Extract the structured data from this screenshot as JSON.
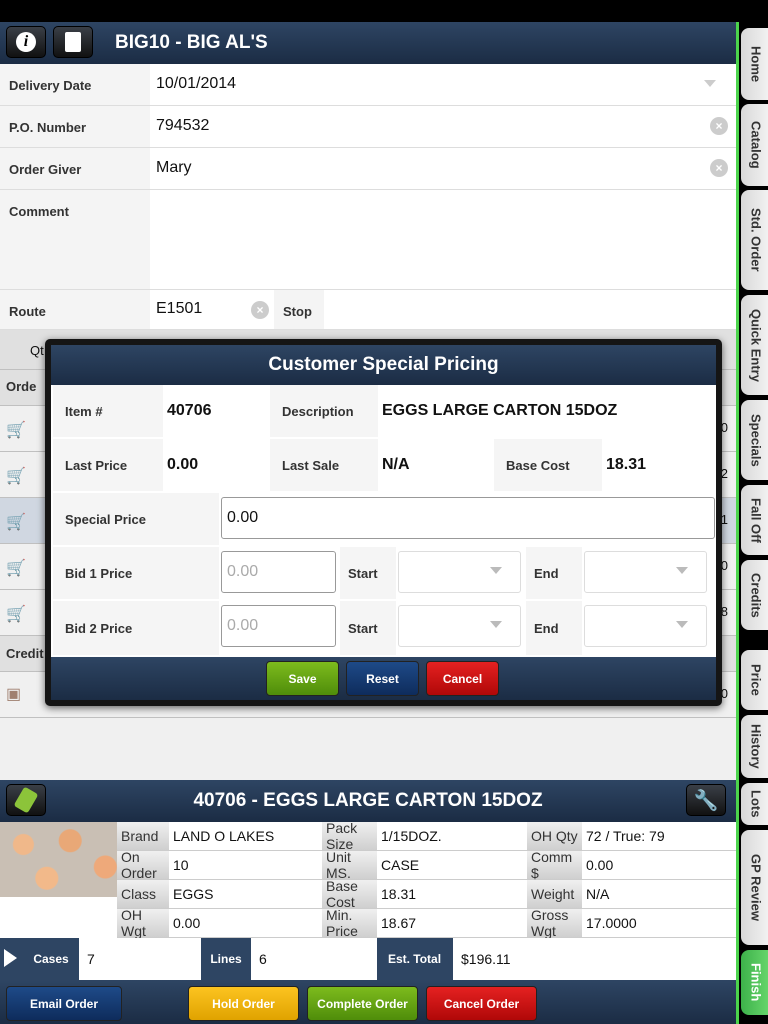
{
  "header": {
    "title": "BIG10 - BIG AL'S",
    "info_icon": "info-icon",
    "calculator_icon": "calculator-icon"
  },
  "form": {
    "delivery_date": {
      "label": "Delivery Date",
      "value": "10/01/2014"
    },
    "po_number": {
      "label": "P.O. Number",
      "value": "794532"
    },
    "order_giver": {
      "label": "Order Giver",
      "value": "Mary"
    },
    "comment": {
      "label": "Comment",
      "value": ""
    },
    "route": {
      "label": "Route",
      "value": "E1501"
    },
    "stop": {
      "label": "Stop",
      "value": ""
    }
  },
  "background_table": {
    "qty_header": "Qt",
    "ordered_section": "Orde",
    "credit_section": "Credit",
    "row_tails": [
      "0",
      "2",
      "1",
      "0",
      "8"
    ],
    "credit_tail": "0"
  },
  "sidebar": {
    "tabs": [
      "Home",
      "Catalog",
      "Std. Order",
      "Quick Entry",
      "Specials",
      "Fall Off",
      "Credits",
      "Price",
      "History",
      "Lots",
      "GP Review",
      "Finish"
    ]
  },
  "dialog": {
    "title": "Customer Special Pricing",
    "item_label": "Item #",
    "item_value": "40706",
    "description_label": "Description",
    "description_value": "EGGS LARGE CARTON 15DOZ",
    "last_price_label": "Last Price",
    "last_price_value": "0.00",
    "last_sale_label": "Last Sale",
    "last_sale_value": "N/A",
    "base_cost_label": "Base Cost",
    "base_cost_value": "18.31",
    "special_price_label": "Special Price",
    "special_price_value": "0.00",
    "bid1_label": "Bid 1 Price",
    "bid1_placeholder": "0.00",
    "bid2_label": "Bid 2 Price",
    "bid2_placeholder": "0.00",
    "start_label": "Start",
    "end_label": "End",
    "save": "Save",
    "reset": "Reset",
    "cancel": "Cancel"
  },
  "product": {
    "title": "40706 - EGGS LARGE CARTON 15DOZ",
    "grid": [
      [
        [
          "Brand",
          "LAND O LAKES"
        ],
        [
          "Pack Size",
          "1/15DOZ."
        ],
        [
          "OH Qty",
          "72 / True: 79"
        ]
      ],
      [
        [
          "On Order",
          "10"
        ],
        [
          "Unit MS.",
          "CASE"
        ],
        [
          "Comm $",
          "0.00"
        ]
      ],
      [
        [
          "Class",
          "EGGS"
        ],
        [
          "Base Cost",
          "18.31"
        ],
        [
          "Weight",
          "N/A"
        ]
      ],
      [
        [
          "OH Wgt",
          "0.00"
        ],
        [
          "Min. Price",
          "18.67"
        ],
        [
          "Gross Wgt",
          "17.0000"
        ]
      ]
    ]
  },
  "totals": {
    "cases_label": "Cases",
    "cases": "7",
    "lines_label": "Lines",
    "lines": "6",
    "est_total_label": "Est. Total",
    "est_total": "$196.11"
  },
  "actions": {
    "email": "Email Order",
    "hold": "Hold Order",
    "complete": "Complete Order",
    "cancel": "Cancel Order"
  },
  "colors": {
    "navy": "#1b2c44",
    "accent_green": "#4cd44c",
    "save": "#5f9e12",
    "reset": "#123a70",
    "cancel": "#d01010",
    "hold": "#f0b410"
  }
}
